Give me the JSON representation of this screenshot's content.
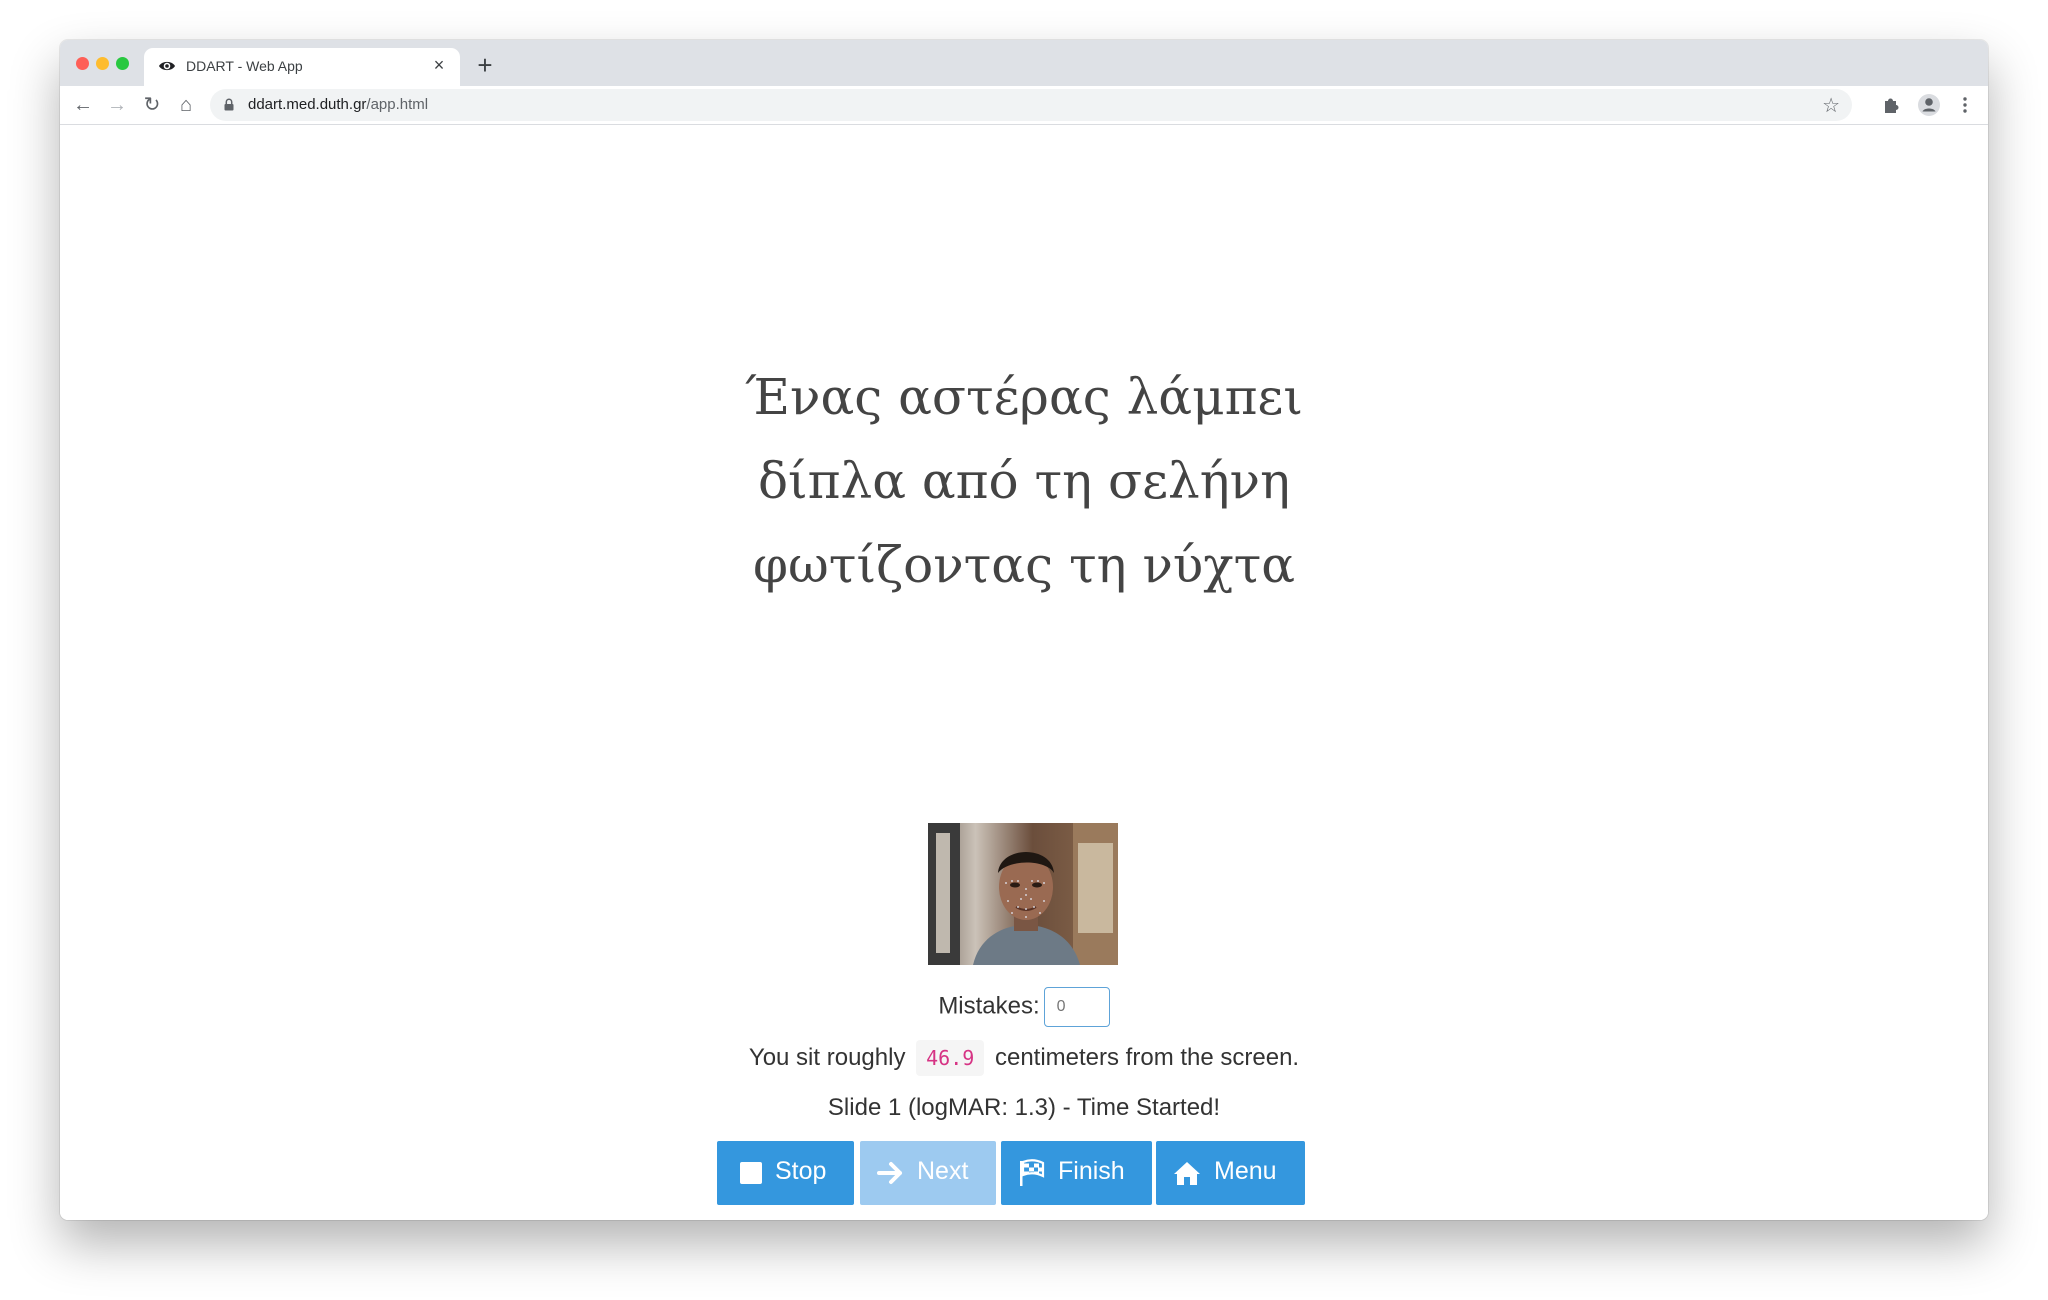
{
  "browser": {
    "tab_title": "DDART - Web App",
    "url_domain": "ddart.med.duth.gr",
    "url_path": "/app.html",
    "tab_close_glyph": "×",
    "new_tab_glyph": "+",
    "back_glyph": "←",
    "forward_glyph": "→",
    "reload_glyph": "↻",
    "home_glyph": "⌂",
    "star_glyph": "☆"
  },
  "reading_text": {
    "lines": [
      "Ένας αστέρας λάμπει",
      "δίπλα από τη σελήνη",
      "φωτίζοντας τη νύχτα"
    ]
  },
  "mistakes": {
    "label": "Mistakes:",
    "value": "0"
  },
  "distance": {
    "prefix": "You sit roughly",
    "value": "46.9",
    "suffix": "centimeters from the screen."
  },
  "status": {
    "text": "Slide 1 (logMAR: 1.3) - Time Started!"
  },
  "buttons": {
    "stop": {
      "label": "Stop",
      "icon": "stop-square-icon",
      "enabled": true
    },
    "next": {
      "label": "Next",
      "icon": "arrow-right-icon",
      "enabled": false
    },
    "finish": {
      "label": "Finish",
      "icon": "checkered-flag-icon",
      "enabled": true
    },
    "menu": {
      "label": "Menu",
      "icon": "home-icon",
      "enabled": true
    }
  },
  "colors": {
    "button_primary": "#3497de",
    "button_disabled": "#9dcaf0",
    "code_text": "#d63384"
  }
}
